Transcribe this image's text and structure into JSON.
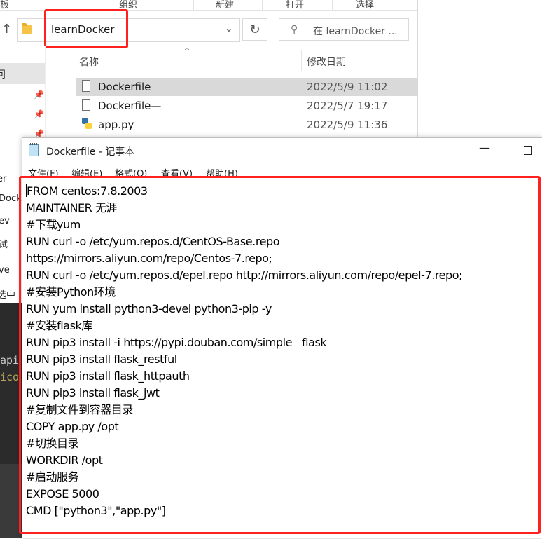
{
  "explorer": {
    "ribbon_groups": [
      "板",
      "组织",
      "新建",
      "打开",
      "选择"
    ],
    "address": "learnDocker",
    "search_placeholder": "在 learnDocker ...",
    "columns": {
      "name": "名称",
      "date": "修改日期"
    },
    "nav_labels": [
      "问",
      "er",
      "Dock",
      "ev",
      "试",
      "ve",
      "选中"
    ],
    "files": [
      {
        "name": "Dockerfile",
        "date": "2022/5/9 11:02",
        "icon": "file-icon",
        "selected": true
      },
      {
        "name": "Dockerfile—",
        "date": "2022/5/7 19:17",
        "icon": "file-icon",
        "selected": false
      },
      {
        "name": "app.py",
        "date": "2022/5/9 11:36",
        "icon": "python-file-icon",
        "selected": false
      }
    ]
  },
  "background_code": [
    "api",
    "ico"
  ],
  "notepad": {
    "title": "Dockerfile - 记事本",
    "menu": [
      "文件(F)",
      "编辑(E)",
      "格式(O)",
      "查看(V)",
      "帮助(H)"
    ],
    "lines": [
      "FROM centos:7.8.2003",
      "MAINTAINER 无涯",
      "#下载yum",
      "RUN curl -o /etc/yum.repos.d/CentOS-Base.repo",
      "https://mirrors.aliyun.com/repo/Centos-7.repo;",
      "RUN curl -o /etc/yum.repos.d/epel.repo http://mirrors.aliyun.com/repo/epel-7.repo;",
      "#安装Python环境",
      "RUN yum install python3-devel python3-pip -y",
      "#安装flask库",
      "RUN pip3 install -i https://pypi.douban.com/simple   flask",
      "RUN pip3 install flask_restful",
      "RUN pip3 install flask_httpauth",
      "RUN pip3 install flask_jwt",
      "#复制文件到容器目录",
      "COPY app.py /opt",
      "#切换目录",
      "WORKDIR /opt",
      "#启动服务",
      "EXPOSE 5000",
      "CMD [\"python3\",\"app.py\"]"
    ]
  },
  "colors": {
    "highlight": "#ff2020",
    "selection": "#d9d9d9"
  }
}
